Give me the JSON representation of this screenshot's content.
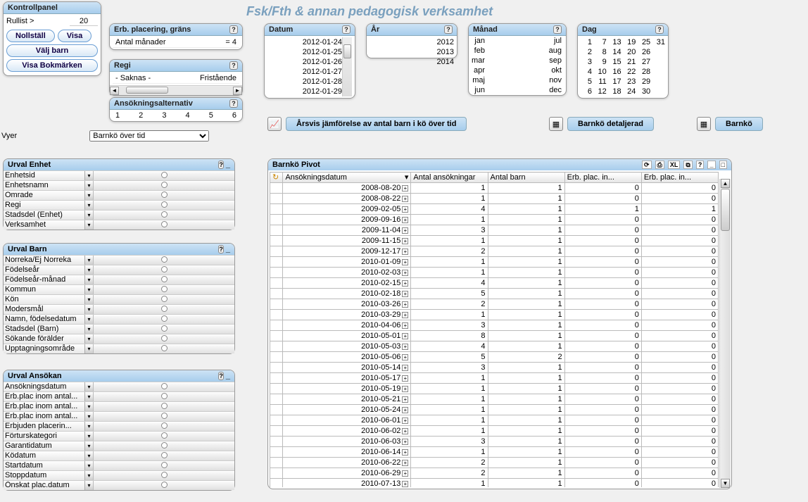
{
  "title": "Fsk/Fth & annan pedagogisk verksamhet",
  "kontroll": {
    "hdr": "Kontrollpanel",
    "rullist": "Rullist >",
    "rullist_val": "20",
    "nollstall": "Nollställ",
    "visa": "Visa",
    "valjbarn": "Välj barn",
    "bokmarken": "Visa Bokmärken"
  },
  "erb": {
    "hdr": "Erb. placering, gräns",
    "l1": "Antal månader",
    "v1": "= 4"
  },
  "regi": {
    "hdr": "Regi",
    "l1": "- Saknas -",
    "l2": "Fristående"
  },
  "ansok": {
    "hdr": "Ansökningsalternativ",
    "vals": [
      "1",
      "2",
      "3",
      "4",
      "5",
      "6"
    ]
  },
  "datum": {
    "hdr": "Datum",
    "items": [
      "2012-01-24",
      "2012-01-25",
      "2012-01-26",
      "2012-01-27",
      "2012-01-28",
      "2012-01-29"
    ]
  },
  "ar": {
    "hdr": "År",
    "items": [
      "2012",
      "2013",
      "2014"
    ]
  },
  "manad": {
    "hdr": "Månad",
    "col1": [
      "jan",
      "feb",
      "mar",
      "apr",
      "maj",
      "jun"
    ],
    "col2": [
      "jul",
      "aug",
      "sep",
      "okt",
      "nov",
      "dec"
    ]
  },
  "dag": {
    "hdr": "Dag",
    "rows": [
      [
        "1",
        "7",
        "13",
        "19",
        "25",
        "31"
      ],
      [
        "2",
        "8",
        "14",
        "20",
        "26",
        ""
      ],
      [
        "3",
        "9",
        "15",
        "21",
        "27",
        ""
      ],
      [
        "4",
        "10",
        "16",
        "22",
        "28",
        ""
      ],
      [
        "5",
        "11",
        "17",
        "23",
        "29",
        ""
      ],
      [
        "6",
        "12",
        "18",
        "24",
        "30",
        ""
      ]
    ]
  },
  "tabs": {
    "arsvis": "Årsvis jämförelse av antal barn i kö över tid",
    "detalj": "Barnkö detaljerad",
    "barnko": "Barnkö"
  },
  "vyer": {
    "label": "Vyer",
    "selected": "Barnkö över tid"
  },
  "enhet": {
    "hdr": "Urval Enhet",
    "items": [
      "Enhetsid",
      "Enhetsnamn",
      "Omrade",
      "Regi",
      "Stadsdel (Enhet)",
      "Verksamhet"
    ]
  },
  "barn": {
    "hdr": "Urval Barn",
    "items": [
      "Norreka/Ej Norreka",
      "Födelseår",
      "Födelseår-månad",
      "Kommun",
      "Kön",
      "Modersmål",
      "Namn, födelsedatum",
      "Stadsdel (Barn)",
      "Sökande förälder",
      "Upptagningsområde"
    ]
  },
  "ansokan": {
    "hdr": "Urval Ansökan",
    "items": [
      "Ansökningsdatum",
      "Erb.plac inom antal...",
      "Erb.plac inom antal...",
      "Erb.plac inom antal...",
      "Erbjuden placerin...",
      "Förturskategori",
      "Garantidatum",
      "Ködatum",
      "Startdatum",
      "Stoppdatum",
      "Önskat plac.datum"
    ]
  },
  "pivot": {
    "hdr": "Barnkö Pivot",
    "cols": [
      "Ansökningsdatum",
      "Antal ansökningar",
      "Antal barn",
      "Erb. plac. in...",
      "Erb. plac. in..."
    ],
    "rows": [
      [
        "2008-08-20",
        "1",
        "1",
        "0",
        "0"
      ],
      [
        "2008-08-22",
        "1",
        "1",
        "0",
        "0"
      ],
      [
        "2009-02-05",
        "4",
        "1",
        "1",
        "1"
      ],
      [
        "2009-09-16",
        "1",
        "1",
        "0",
        "0"
      ],
      [
        "2009-11-04",
        "3",
        "1",
        "0",
        "0"
      ],
      [
        "2009-11-15",
        "1",
        "1",
        "0",
        "0"
      ],
      [
        "2009-12-17",
        "2",
        "1",
        "0",
        "0"
      ],
      [
        "2010-01-09",
        "1",
        "1",
        "0",
        "0"
      ],
      [
        "2010-02-03",
        "1",
        "1",
        "0",
        "0"
      ],
      [
        "2010-02-15",
        "4",
        "1",
        "0",
        "0"
      ],
      [
        "2010-02-18",
        "5",
        "1",
        "0",
        "0"
      ],
      [
        "2010-03-26",
        "2",
        "1",
        "0",
        "0"
      ],
      [
        "2010-03-29",
        "1",
        "1",
        "0",
        "0"
      ],
      [
        "2010-04-06",
        "3",
        "1",
        "0",
        "0"
      ],
      [
        "2010-05-01",
        "8",
        "1",
        "0",
        "0"
      ],
      [
        "2010-05-03",
        "4",
        "1",
        "0",
        "0"
      ],
      [
        "2010-05-06",
        "5",
        "2",
        "0",
        "0"
      ],
      [
        "2010-05-14",
        "3",
        "1",
        "0",
        "0"
      ],
      [
        "2010-05-17",
        "1",
        "1",
        "0",
        "0"
      ],
      [
        "2010-05-19",
        "1",
        "1",
        "0",
        "0"
      ],
      [
        "2010-05-21",
        "1",
        "1",
        "0",
        "0"
      ],
      [
        "2010-05-24",
        "1",
        "1",
        "0",
        "0"
      ],
      [
        "2010-06-01",
        "1",
        "1",
        "0",
        "0"
      ],
      [
        "2010-06-02",
        "1",
        "1",
        "0",
        "0"
      ],
      [
        "2010-06-03",
        "3",
        "1",
        "0",
        "0"
      ],
      [
        "2010-06-14",
        "1",
        "1",
        "0",
        "0"
      ],
      [
        "2010-06-22",
        "2",
        "1",
        "0",
        "0"
      ],
      [
        "2010-06-29",
        "2",
        "1",
        "0",
        "0"
      ],
      [
        "2010-07-13",
        "1",
        "1",
        "0",
        "0"
      ]
    ]
  }
}
